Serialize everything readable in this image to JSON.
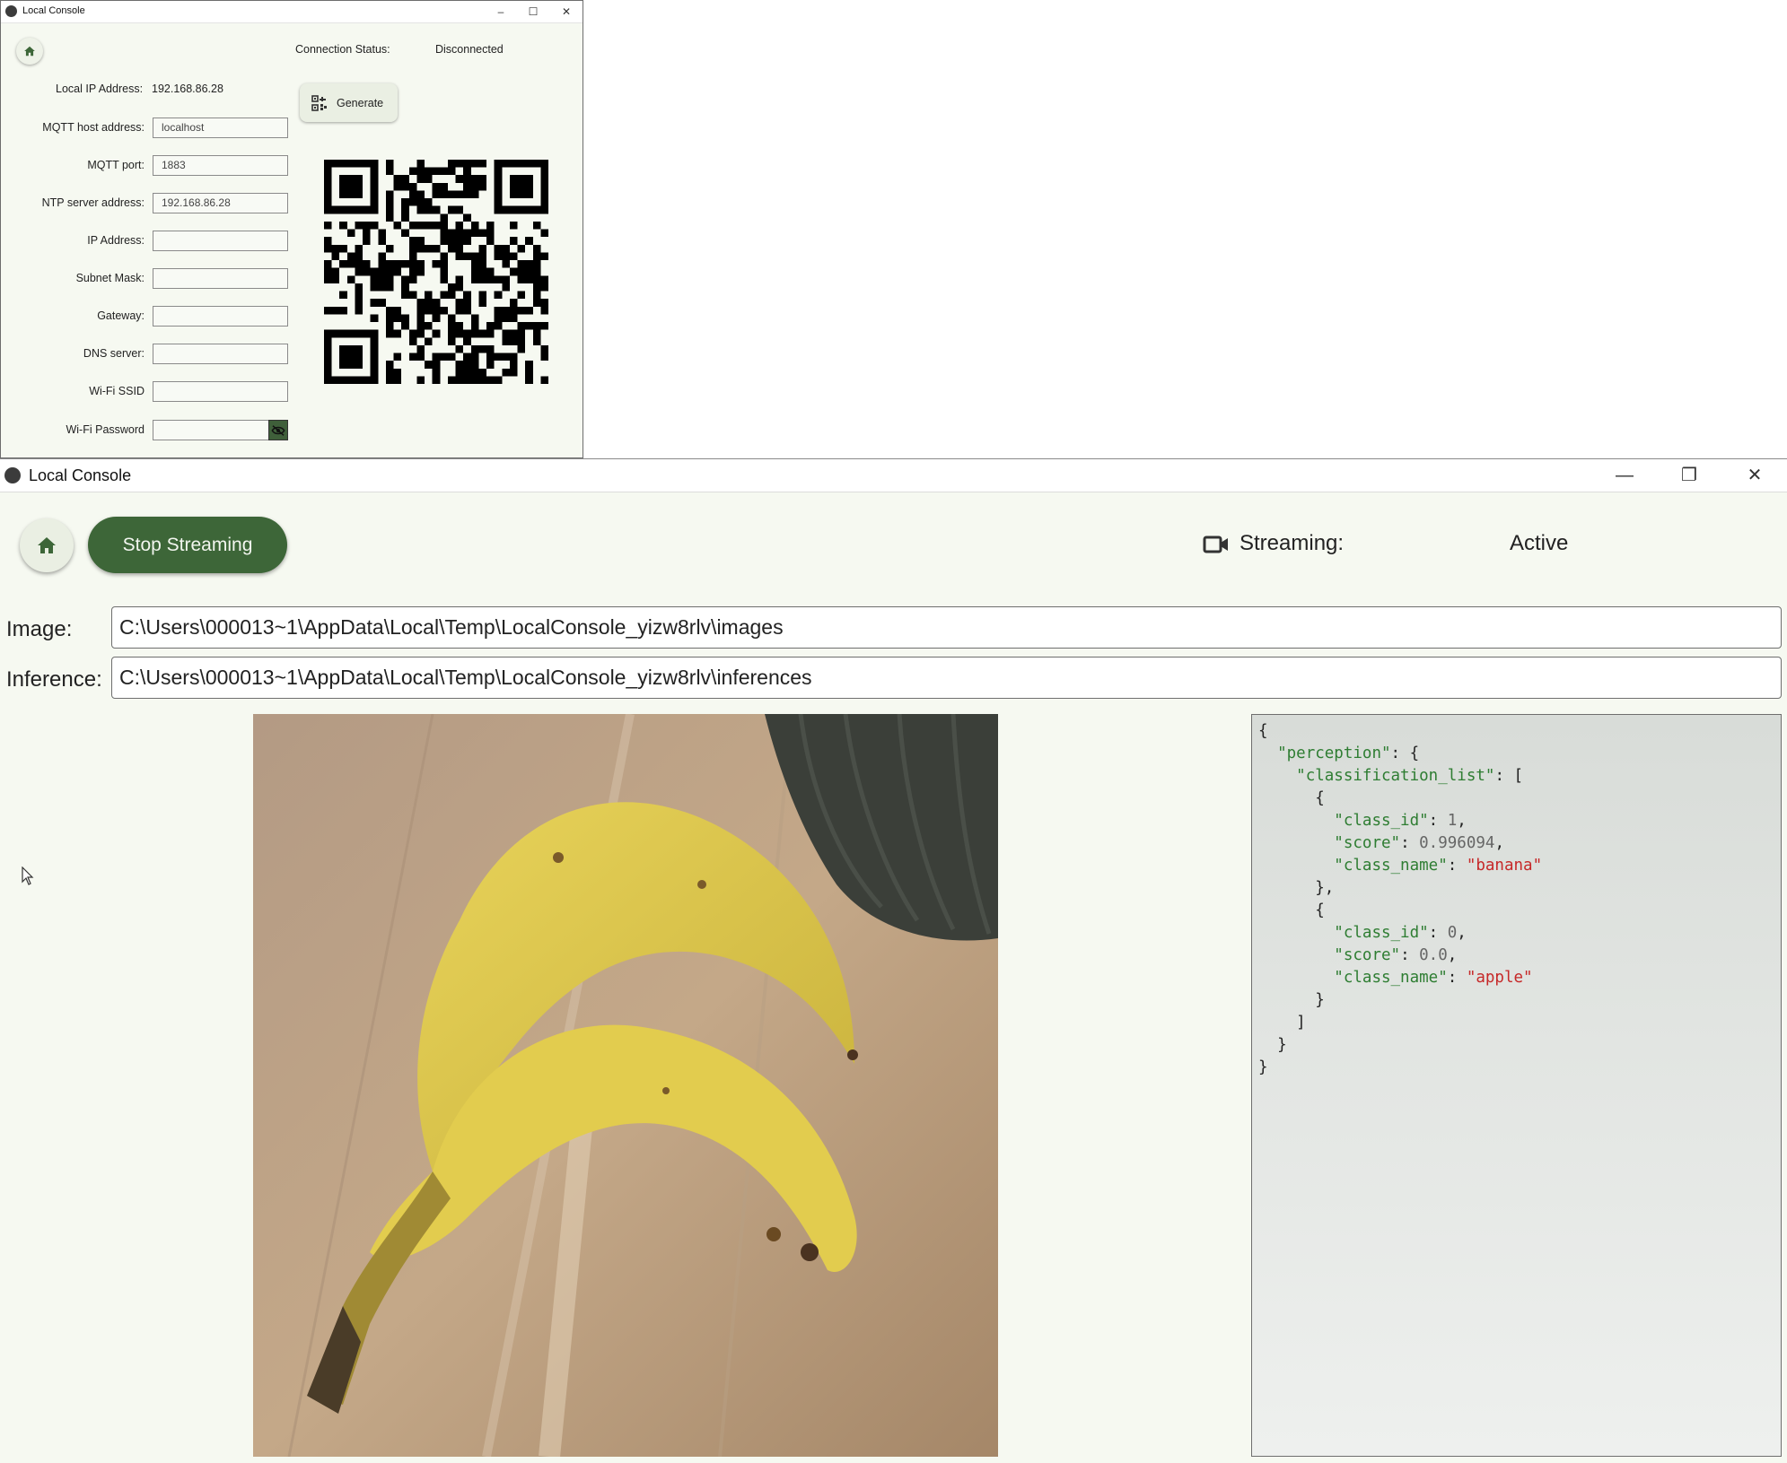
{
  "setup_window": {
    "title": "Local Console",
    "controls": {
      "minimize": "–",
      "maximize": "☐",
      "close": "✕"
    },
    "connection_status_label": "Connection Status:",
    "connection_status_value": "Disconnected",
    "local_ip_label": "Local IP Address:",
    "local_ip_value": "192.168.86.28",
    "generate_label": "Generate",
    "fields": [
      {
        "label": "MQTT host address:",
        "value": "localhost"
      },
      {
        "label": "MQTT port:",
        "value": "1883"
      },
      {
        "label": "NTP server address:",
        "value": "192.168.86.28"
      },
      {
        "label": "IP Address:",
        "value": ""
      },
      {
        "label": "Subnet Mask:",
        "value": ""
      },
      {
        "label": "Gateway:",
        "value": ""
      },
      {
        "label": "DNS server:",
        "value": ""
      },
      {
        "label": "Wi-Fi SSID",
        "value": ""
      },
      {
        "label": "Wi-Fi Password",
        "value": ""
      }
    ]
  },
  "stream_window": {
    "title": "Local Console",
    "controls": {
      "minimize": "—",
      "restore": "❐",
      "close": "✕"
    },
    "stop_button_label": "Stop Streaming",
    "streaming_label": "Streaming:",
    "streaming_value": "Active",
    "image_label": "Image:",
    "image_path": "C:\\Users\\000013~1\\AppData\\Local\\Temp\\LocalConsole_yizw8rlv\\images",
    "inference_label": "Inference:",
    "inference_path": "C:\\Users\\000013~1\\AppData\\Local\\Temp\\LocalConsole_yizw8rlv\\inferences",
    "inference_json": {
      "root_key": "perception",
      "list_key": "classification_list",
      "items": [
        {
          "class_id": "1",
          "score": "0.996094",
          "class_name": "banana"
        },
        {
          "class_id": "0",
          "score": "0.0",
          "class_name": "apple"
        }
      ]
    }
  }
}
